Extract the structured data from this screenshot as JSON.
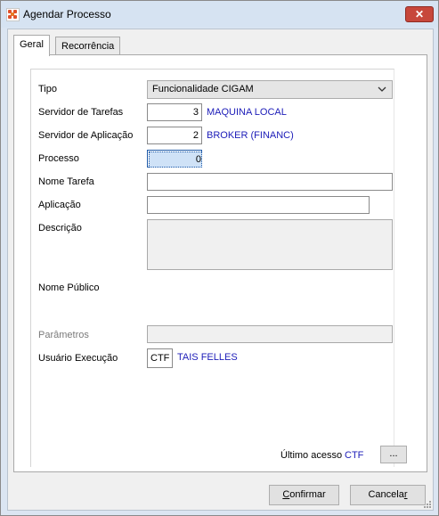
{
  "window": {
    "title": "Agendar Processo",
    "close_label": "✕"
  },
  "tabs": [
    {
      "label": "Geral",
      "active": true
    },
    {
      "label": "Recorrência",
      "active": false
    }
  ],
  "form": {
    "tipo": {
      "label": "Tipo",
      "value": "Funcionalidade CIGAM"
    },
    "servidor_tarefas": {
      "label": "Servidor de Tarefas",
      "value": "3",
      "desc": "MAQUINA LOCAL"
    },
    "servidor_aplicacao": {
      "label": "Servidor de Aplicação",
      "value": "2",
      "desc": "BROKER (FINANC)"
    },
    "processo": {
      "label": "Processo",
      "value": "0"
    },
    "nome_tarefa": {
      "label": "Nome Tarefa",
      "value": ""
    },
    "aplicacao": {
      "label": "Aplicação",
      "value": ""
    },
    "descricao": {
      "label": "Descrição",
      "value": ""
    },
    "nome_publico": {
      "label": "Nome Público"
    },
    "parametros": {
      "label": "Parâmetros",
      "value": ""
    },
    "usuario_execucao": {
      "label": "Usuário Execução",
      "value": "CTF",
      "desc": "TAIS FELLES"
    }
  },
  "ultimo_acesso": {
    "label": "Último acesso",
    "value": "CTF",
    "button_label": "..."
  },
  "buttons": {
    "confirm_first": "C",
    "confirm_rest": "onfirmar",
    "cancel_first": "Cancela",
    "cancel_underline": "r"
  },
  "colors": {
    "title_bar": "#d6e3f2",
    "close_button": "#c7473b",
    "link_text": "#1c1cb8",
    "focus_selection": "#cfe2f7"
  },
  "icons": {
    "app": "cigam-app-icon",
    "close": "close-icon",
    "combo": "chevron-down-icon",
    "resize": "resize-grip-icon"
  }
}
